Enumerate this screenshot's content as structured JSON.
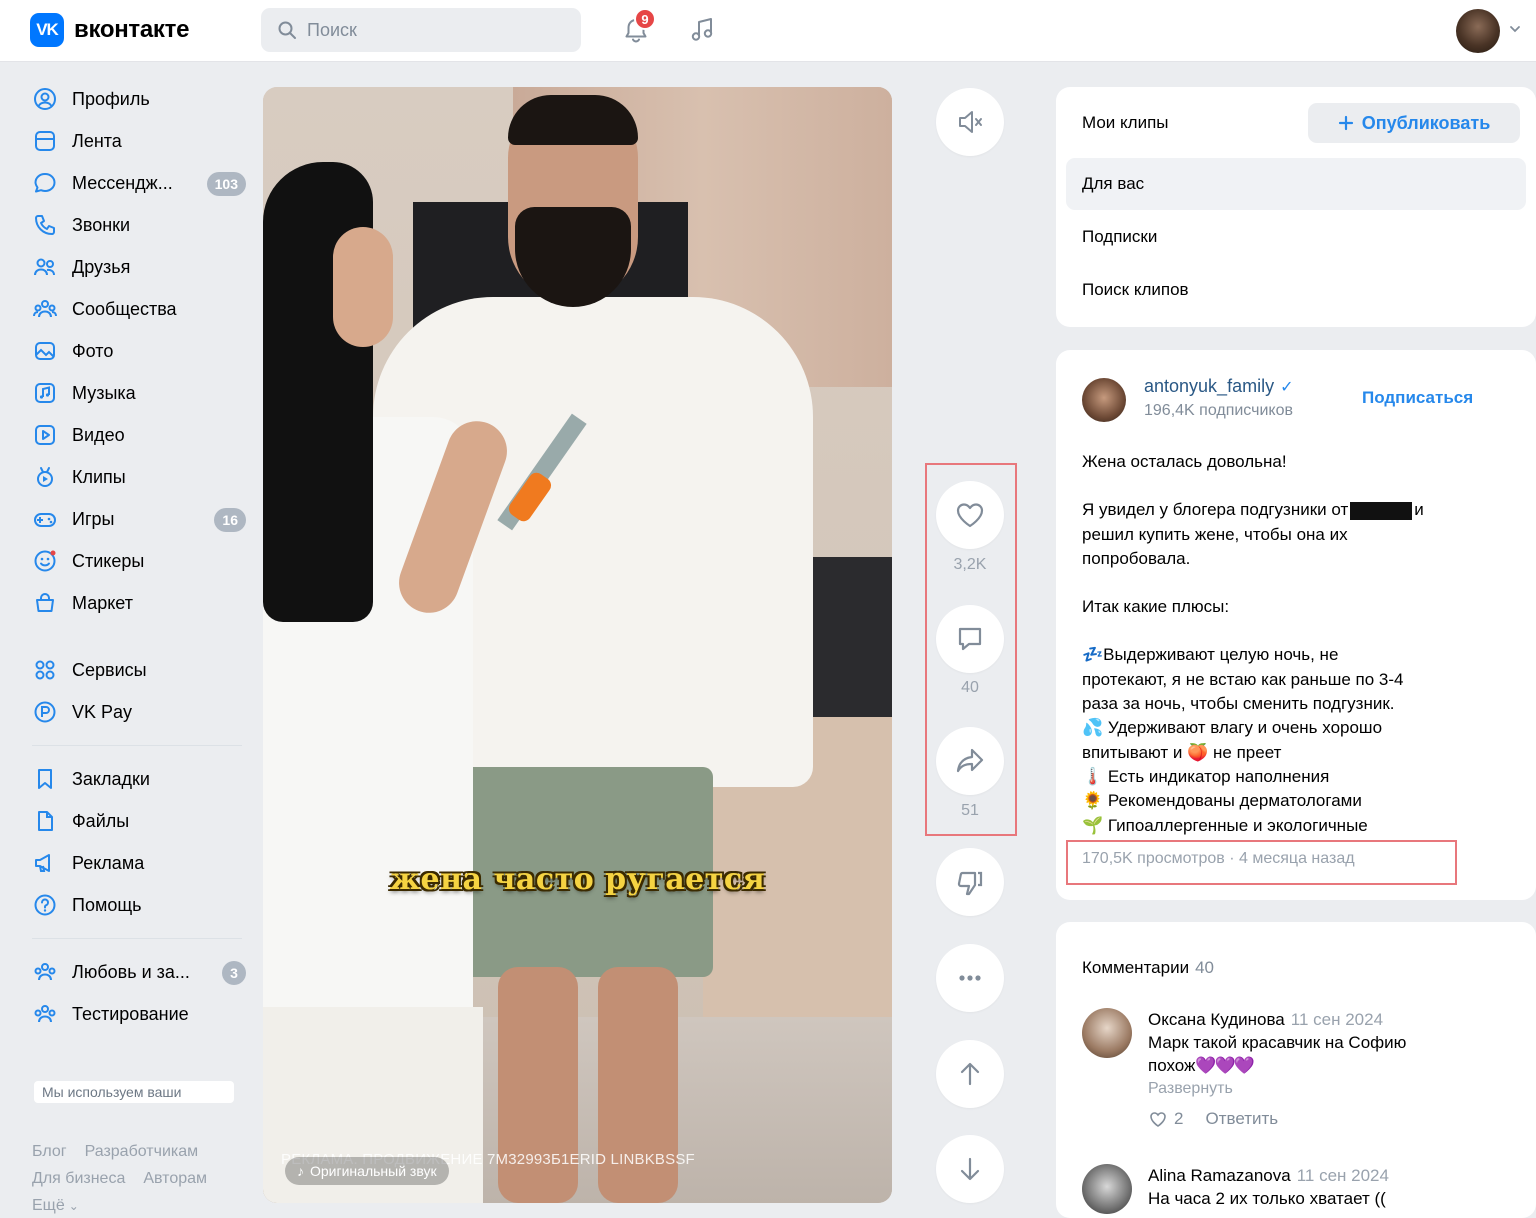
{
  "header": {
    "logo_mark": "VK",
    "logo_text": "вконтакте",
    "search_placeholder": "Поиск",
    "notifications_count": "9"
  },
  "sidebar": {
    "group1": [
      {
        "label": "Профиль",
        "icon": "profile-icon"
      },
      {
        "label": "Лента",
        "icon": "feed-icon"
      },
      {
        "label": "Мессендж...",
        "icon": "messenger-icon",
        "count": "103"
      },
      {
        "label": "Звонки",
        "icon": "phone-icon"
      },
      {
        "label": "Друзья",
        "icon": "friends-icon"
      },
      {
        "label": "Сообщества",
        "icon": "communities-icon"
      },
      {
        "label": "Фото",
        "icon": "photo-icon"
      },
      {
        "label": "Музыка",
        "icon": "music-icon"
      },
      {
        "label": "Видео",
        "icon": "video-icon"
      },
      {
        "label": "Клипы",
        "icon": "clips-icon"
      },
      {
        "label": "Игры",
        "icon": "games-icon",
        "count": "16"
      },
      {
        "label": "Стикеры",
        "icon": "stickers-icon"
      },
      {
        "label": "Маркет",
        "icon": "market-icon"
      }
    ],
    "group2": [
      {
        "label": "Сервисы",
        "icon": "services-icon"
      },
      {
        "label": "VK Pay",
        "icon": "vkpay-icon"
      }
    ],
    "group3": [
      {
        "label": "Закладки",
        "icon": "bookmarks-icon"
      },
      {
        "label": "Файлы",
        "icon": "files-icon"
      },
      {
        "label": "Реклама",
        "icon": "ads-icon"
      },
      {
        "label": "Помощь",
        "icon": "help-icon"
      }
    ],
    "group4": [
      {
        "label": "Любовь и за...",
        "icon": "group-icon",
        "count": "3"
      },
      {
        "label": "Тестирование",
        "icon": "group-icon"
      }
    ],
    "cookie_notice": "Мы используем ваши",
    "footer": {
      "blog": "Блог",
      "developers": "Разработчикам",
      "business": "Для бизнеса",
      "authors": "Авторам",
      "more": "Ещё"
    }
  },
  "video": {
    "subtitle": "жена часто ругается",
    "ad_line": "РЕКЛАМА. ПРОДВИЖЕНИЕ 7М32993Б1ERID LINBKBSSF",
    "audio_label": "Оригинальный звук"
  },
  "actions": {
    "likes": "3,2K",
    "comments": "40",
    "shares": "51"
  },
  "clips_menu": {
    "title": "Мои клипы",
    "publish": "Опубликовать",
    "items": [
      "Для вас",
      "Подписки",
      "Поиск клипов"
    ]
  },
  "post": {
    "author": "antonyuk_family",
    "subscribers": "196,4K подписчиков",
    "subscribe": "Подписаться",
    "lines": [
      "Жена осталась довольна!",
      "",
      "Я увидел у блогера подгузники от",
      "решил купить жене, чтобы она их",
      "попробовала.",
      "",
      "Итак какие плюсы:",
      "",
      "💤Выдерживают целую ночь, не",
      "протекают, я не встаю как раньше по 3-4",
      "раза за ночь, чтобы сменить подгузник.",
      "💦 Удерживают влагу и очень хорошо",
      "впитывают и 🍑 не преет",
      "🌡️ Есть индикатор наполнения",
      "🌻 Рекомендованы дерматологами",
      "🌱 Гипоаллергенные и экологичные"
    ],
    "line3_tail": "и",
    "meta": "170,5K просмотров · 4 месяца назад"
  },
  "comments": {
    "title": "Комментарии",
    "count": "40",
    "items": [
      {
        "name": "Оксана Кудинова",
        "time": "11 сен 2024",
        "text_line1": "Марк такой красавчик на Софию",
        "text_line2": "похож",
        "hearts": "💜💜💜",
        "expand": "Развернуть",
        "likes": "2",
        "reply": "Ответить"
      },
      {
        "name": "Alina Ramazanova",
        "time": "11 сен 2024",
        "text_line1": "На часа 2 их только хватает (("
      }
    ]
  },
  "colors": {
    "accent": "#2688eb",
    "brand": "#0077ff",
    "background": "#ebedf0",
    "highlight_box": "#e8777c"
  }
}
